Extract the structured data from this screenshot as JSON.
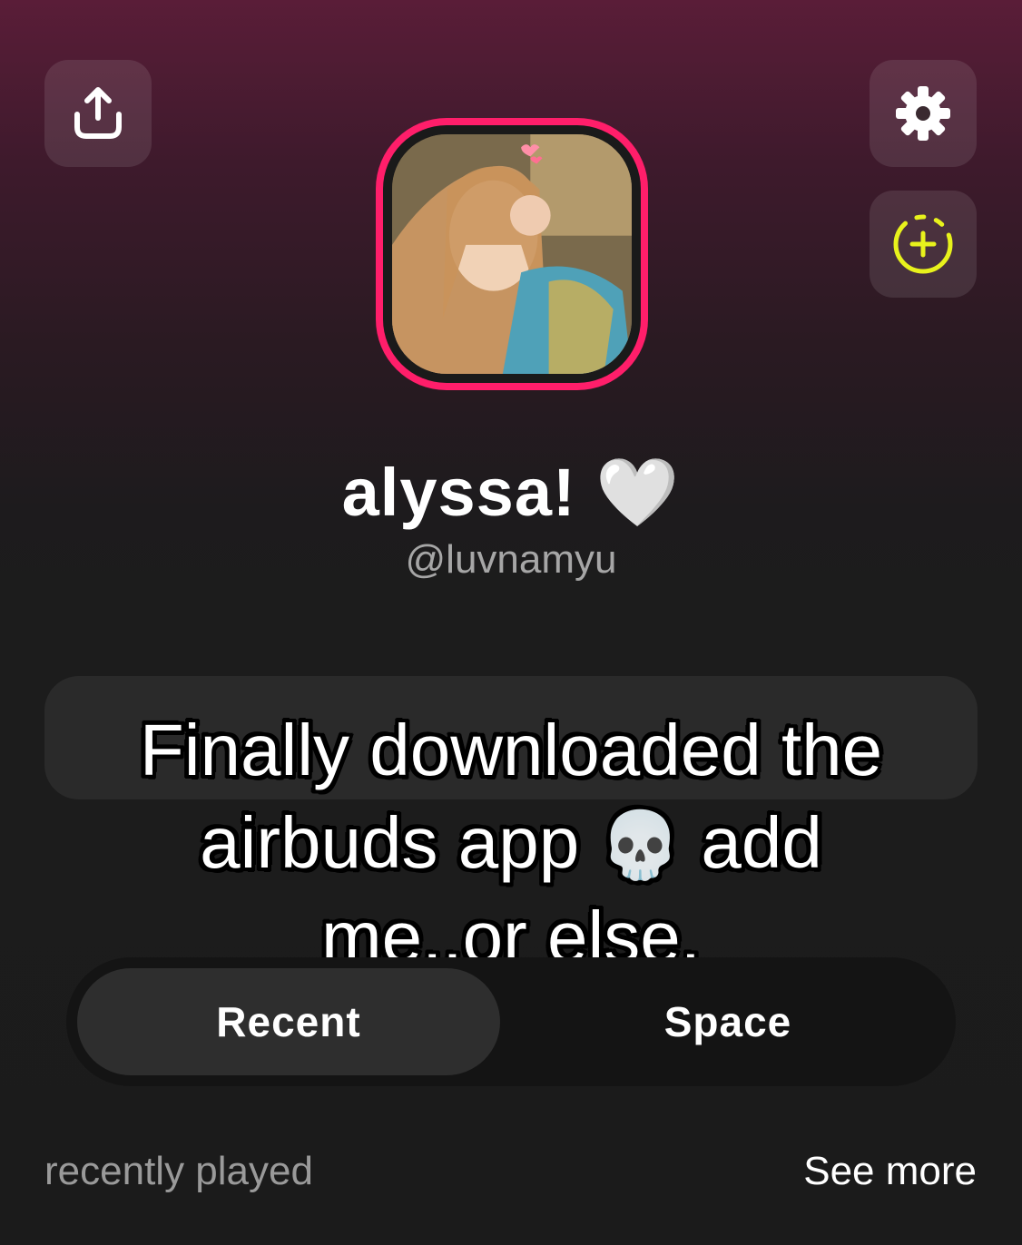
{
  "header": {
    "share_icon": "share-upload-icon",
    "settings_icon": "gear-icon",
    "add_story_icon": "add-story-icon",
    "accent_color": "#ff1e6a",
    "story_add_color": "#e8f21c"
  },
  "profile": {
    "display_name": "alyssa!",
    "name_emoji": "🤍",
    "username": "@luvnamyu"
  },
  "overlay": {
    "caption_line1": "Finally downloaded the",
    "caption_line2a": "airbuds app",
    "caption_emoji": "💀",
    "caption_line2b": "add",
    "caption_line3": "me..or else."
  },
  "tabs": [
    {
      "label": "Recent",
      "selected": true
    },
    {
      "label": "Space",
      "selected": false
    }
  ],
  "recent_section": {
    "title": "recently played",
    "see_more": "See more"
  }
}
